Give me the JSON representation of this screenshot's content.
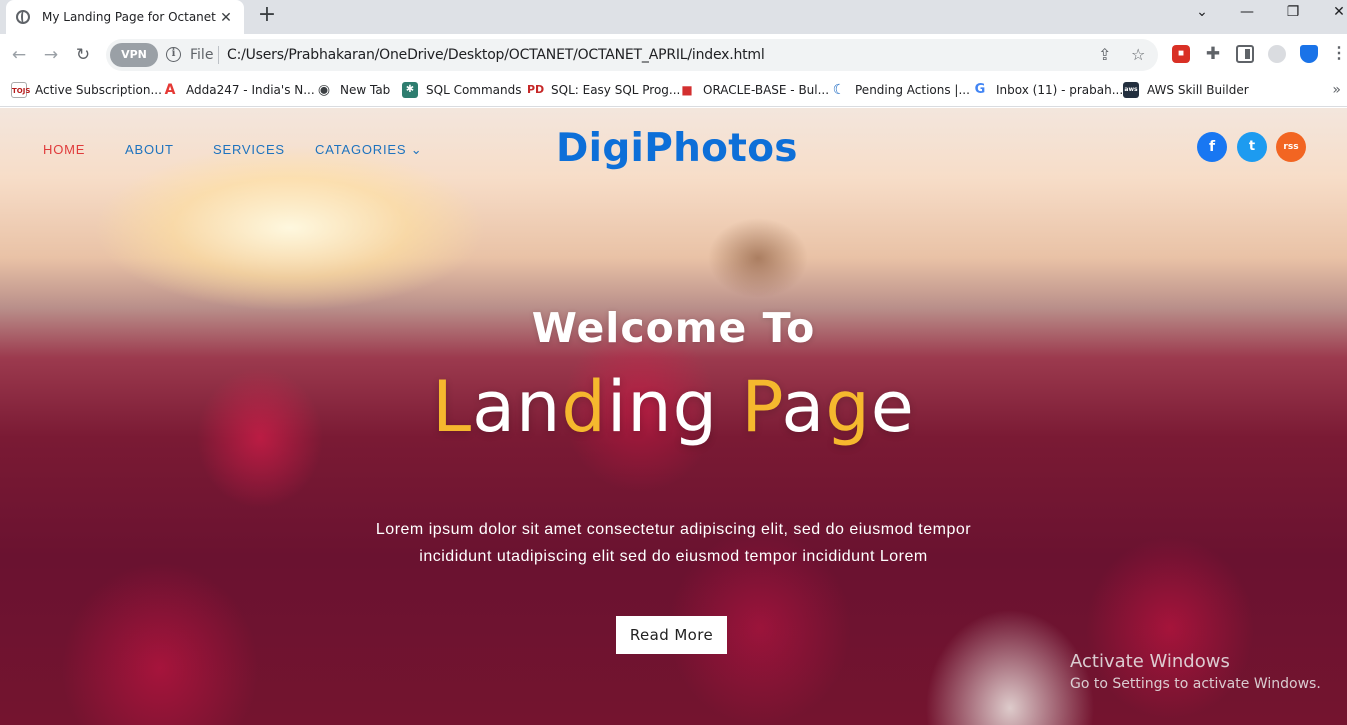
{
  "browser": {
    "tab_title": "My Landing Page for Octanet",
    "tab_close": "✕",
    "new_tab": "+",
    "vpn_label": "VPN",
    "url_scheme": "File",
    "url": "C:/Users/Prabhakaran/OneDrive/Desktop/OCTANET/OCTANET_APRIL/index.html",
    "bookmarks": [
      {
        "label": "Active Subscription...",
        "icon": "tojs-icon",
        "icon_text": "TOJS"
      },
      {
        "label": "Adda247 - India's N...",
        "icon": "adda-icon",
        "icon_text": "A"
      },
      {
        "label": "New Tab",
        "icon": "globe-icon",
        "icon_text": "◉"
      },
      {
        "label": "SQL Commands",
        "icon": "sql-icon",
        "icon_text": "✱"
      },
      {
        "label": "SQL: Easy SQL Prog...",
        "icon": "pd-icon",
        "icon_text": "PD"
      },
      {
        "label": "ORACLE-BASE - Bul...",
        "icon": "oracle-icon",
        "icon_text": "■"
      },
      {
        "label": "Pending Actions |...",
        "icon": "moon-icon",
        "icon_text": "☾"
      },
      {
        "label": "Inbox (11) - prabah...",
        "icon": "google-icon",
        "icon_text": "G"
      },
      {
        "label": "AWS Skill Builder",
        "icon": "aws-icon",
        "icon_text": "aws"
      }
    ]
  },
  "page": {
    "nav": {
      "home": "HOME",
      "about": "ABOUT",
      "services": "SERVICES",
      "categories": "CATAGORIES ⌄"
    },
    "brand": "DigiPhotos",
    "social": {
      "facebook": "f",
      "twitter": "t",
      "rss": "rss"
    },
    "welcome": "Welcome To",
    "landing_parts": [
      "L",
      "an",
      "d",
      "ing ",
      "P",
      "a",
      "g",
      "e"
    ],
    "description_line1": "Lorem ipsum dolor sit amet consectetur adipiscing elit, sed do eiusmod tempor",
    "description_line2": "incididunt utadipiscing elit sed do eiusmod tempor incididunt Lorem",
    "read_more": "Read More",
    "watermark_title": "Activate Windows",
    "watermark_sub": "Go to Settings to activate Windows."
  },
  "colors": {
    "brand": "#0d6fd8",
    "nav_link": "#1e73be",
    "nav_active": "#e03b3b",
    "accent_yellow": "#f5b82e",
    "facebook": "#1877f2",
    "twitter": "#1d9bf0",
    "rss": "#f26522"
  }
}
